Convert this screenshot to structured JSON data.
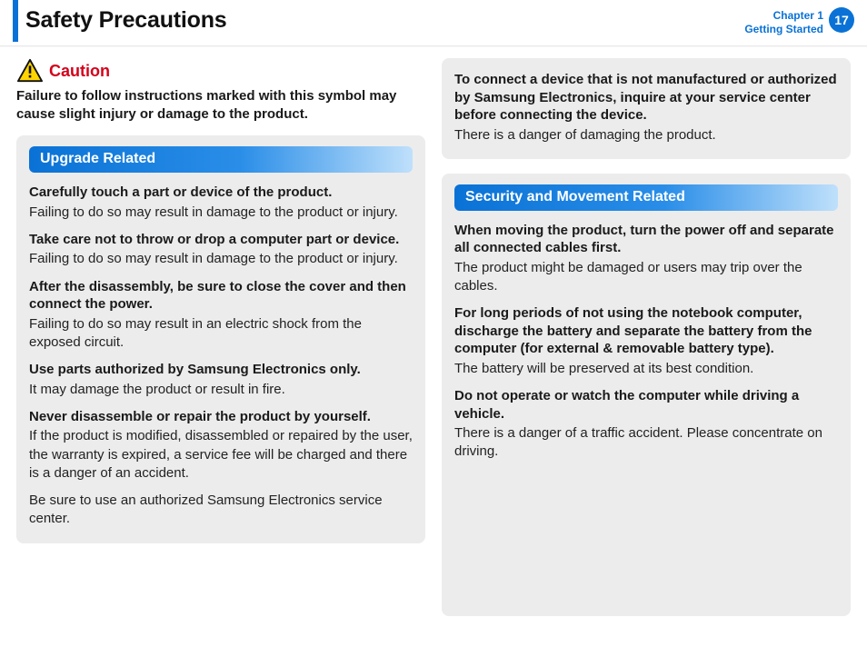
{
  "header": {
    "title": "Safety Precautions",
    "chapter_line1": "Chapter 1",
    "chapter_line2": "Getting Started",
    "page_number": "17"
  },
  "caution": {
    "label": "Caution",
    "intro": "Failure to follow instructions marked with this symbol may cause slight injury or damage to the product."
  },
  "upgrade": {
    "heading": "Upgrade Related",
    "items": [
      {
        "strong": "Carefully touch a part or device of the product.",
        "body": "Failing to do so may result in damage to the product or injury."
      },
      {
        "strong": "Take care not to throw or drop a computer part or device.",
        "body": "Failing to do so may result in damage to the product or injury."
      },
      {
        "strong": "After the disassembly, be sure to close the cover and then connect the power.",
        "body": "Failing to do so may result in an electric shock from the exposed circuit."
      },
      {
        "strong": "Use parts authorized by Samsung Electronics only.",
        "body": "It may damage the product or result in fire."
      },
      {
        "strong": "Never disassemble or repair the product by yourself.",
        "body": "If the product is modified, disassembled or repaired by the user, the warranty is expired, a service fee will be charged and there is a danger of an accident."
      },
      {
        "strong": "",
        "body": "Be sure to use an authorized Samsung Electronics service center."
      }
    ]
  },
  "unauth": {
    "strong": "To connect a device that is not manufactured or authorized by Samsung Electronics, inquire at your service center before connecting the device.",
    "body": "There is a danger of damaging the product."
  },
  "security": {
    "heading": "Security and Movement Related",
    "items": [
      {
        "strong": "When moving the product, turn the power off and separate all connected cables first.",
        "body": "The product might be damaged or users may trip over the cables."
      },
      {
        "strong": "For long periods of not using the notebook computer, discharge the battery and separate the battery from the computer (for external & removable battery type).",
        "body": "The battery will be preserved at its best condition."
      },
      {
        "strong": "Do not operate or watch the computer while driving a vehicle.",
        "body": "There is a danger of a traffic accident. Please concentrate on driving."
      }
    ]
  }
}
